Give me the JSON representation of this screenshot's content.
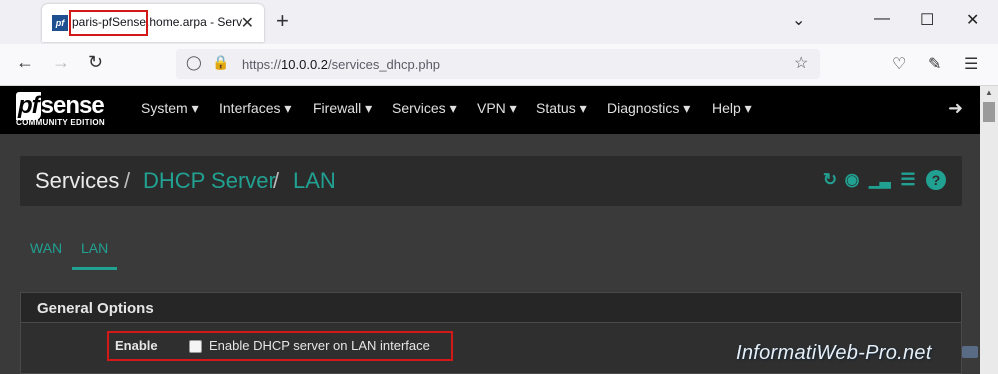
{
  "browser": {
    "tab_favicon": "pf",
    "tab_title": "paris-pfSense.home.arpa - Servi",
    "tab_close": "✕",
    "new_tab": "+",
    "window_controls": {
      "dropdown": "⌄",
      "minimize": "—",
      "maximize": "☐",
      "close": "✕"
    },
    "url": {
      "scheme": "https://",
      "host": "10.0.0.2",
      "path": "/services_dhcp.php"
    }
  },
  "pfsense": {
    "logo": {
      "pf": "pf",
      "sense": "sense",
      "sub": "COMMUNITY EDITION"
    },
    "menu": [
      "System ▾",
      "Interfaces ▾",
      "Firewall ▾",
      "Services ▾",
      "VPN ▾",
      "Status ▾",
      "Diagnostics ▾",
      "Help ▾"
    ],
    "logout_icon": "logout-icon"
  },
  "breadcrumb": {
    "first": "Services",
    "second": "DHCP Server",
    "third": "LAN",
    "sep": "/"
  },
  "toolbar_icons": [
    "restart-icon",
    "stop-icon",
    "chart-icon",
    "list-icon",
    "help-icon"
  ],
  "subtabs": [
    "WAN",
    "LAN"
  ],
  "panel": {
    "title": "General Options",
    "enable_label": "Enable",
    "checkbox_text": "Enable DHCP server on LAN interface",
    "checked": false
  },
  "watermark": "InformatiWeb-Pro.net",
  "colors": {
    "accent": "#21a192",
    "highlight": "#d31818"
  }
}
